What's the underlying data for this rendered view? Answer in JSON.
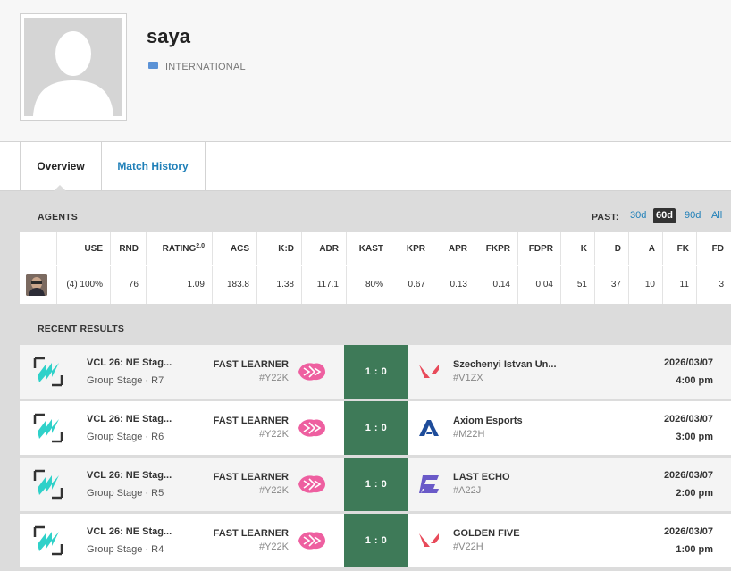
{
  "player": {
    "name": "saya",
    "country": "INTERNATIONAL"
  },
  "tabs": [
    {
      "label": "Overview",
      "active": true
    },
    {
      "label": "Match History",
      "active": false
    }
  ],
  "agents_section": {
    "title": "AGENTS",
    "past_label": "PAST:",
    "past_options": [
      "30d",
      "60d",
      "90d",
      "All"
    ],
    "past_selected": "60d",
    "columns": [
      "USE",
      "RND",
      "RATING",
      "ACS",
      "K:D",
      "ADR",
      "KAST",
      "KPR",
      "APR",
      "FKPR",
      "FDPR",
      "K",
      "D",
      "A",
      "FK",
      "FD"
    ],
    "rating_sup": "2.0",
    "rows": [
      {
        "agent_icon": "agent-portrait-icon",
        "values": [
          "(4) 100%",
          "76",
          "1.09",
          "183.8",
          "1.38",
          "117.1",
          "80%",
          "0.67",
          "0.13",
          "0.14",
          "0.04",
          "51",
          "37",
          "10",
          "11",
          "3"
        ]
      }
    ]
  },
  "results_section": {
    "title": "RECENT RESULTS",
    "matches": [
      {
        "event": "VCL 26: NE Stag...",
        "stage": "Group Stage",
        "sep": " · ",
        "round": "R7",
        "team1": "FAST LEARNER",
        "team1_tag": "#Y22K",
        "score": "1 : 0",
        "team2": "Szechenyi Istvan Un...",
        "team2_tag": "#V1ZX",
        "team2_logo": "valorant-logo-icon",
        "date": "2026/03/07",
        "time": "4:00 pm"
      },
      {
        "event": "VCL 26: NE Stag...",
        "stage": "Group Stage",
        "sep": " · ",
        "round": "R6",
        "team1": "FAST LEARNER",
        "team1_tag": "#Y22K",
        "score": "1 : 0",
        "team2": "Axiom Esports",
        "team2_tag": "#M22H",
        "team2_logo": "axiom-logo-icon",
        "date": "2026/03/07",
        "time": "3:00 pm"
      },
      {
        "event": "VCL 26: NE Stag...",
        "stage": "Group Stage",
        "sep": " · ",
        "round": "R5",
        "team1": "FAST LEARNER",
        "team1_tag": "#Y22K",
        "score": "1 : 0",
        "team2": "LAST ECHO",
        "team2_tag": "#A22J",
        "team2_logo": "last-echo-logo-icon",
        "date": "2026/03/07",
        "time": "2:00 pm"
      },
      {
        "event": "VCL 26: NE Stag...",
        "stage": "Group Stage",
        "sep": " · ",
        "round": "R4",
        "team1": "FAST LEARNER",
        "team1_tag": "#Y22K",
        "score": "1 : 0",
        "team2": "GOLDEN FIVE",
        "team2_tag": "#V22H",
        "team2_logo": "valorant-logo-icon",
        "date": "2026/03/07",
        "time": "1:00 pm"
      }
    ]
  },
  "colors": {
    "link": "#1e7fb8",
    "win_score_bg": "#3e7a58",
    "team1_logo": "#ee5fa0",
    "valorant_red": "#e84a5a",
    "axiom_blue": "#1e4c9a",
    "last_echo_purple": "#6a5ac8",
    "event_cyan": "#2fd1c9"
  }
}
